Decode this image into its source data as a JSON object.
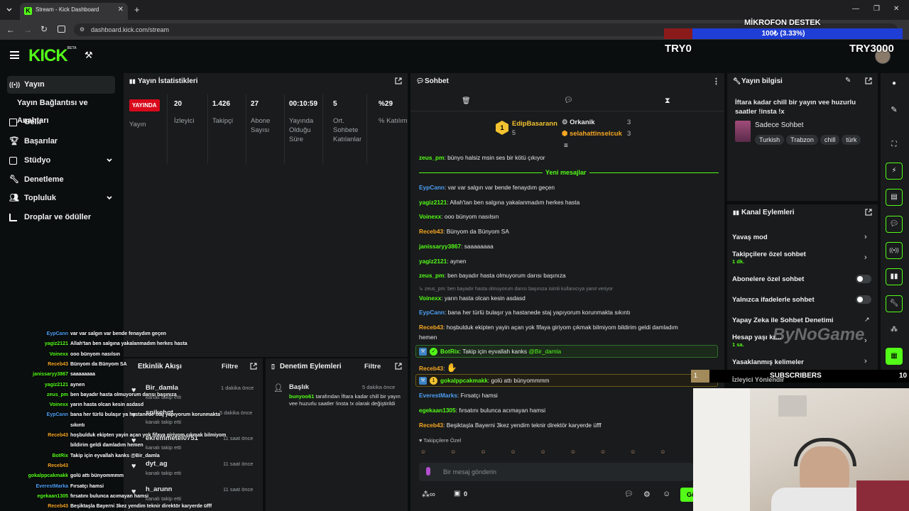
{
  "browser": {
    "tab_title": "Stream - Kick Dashboard",
    "url": "dashboard.kick.com/stream"
  },
  "brand": {
    "logo": "KICK",
    "beta": "BETA",
    "accent": "#53fc18"
  },
  "sidebar": {
    "items": [
      {
        "label": "Yayın",
        "icon": "broadcast-icon"
      },
      {
        "label": "Yayın Bağlantısı ve Anahtarı",
        "icon": ""
      },
      {
        "label": "Gelir",
        "icon": "revenue-icon"
      },
      {
        "label": "Başarılar",
        "icon": "trophy-icon"
      },
      {
        "label": "Stüdyo",
        "icon": "studio-icon"
      },
      {
        "label": "Denetleme",
        "icon": "wrench-icon"
      },
      {
        "label": "Topluluk",
        "icon": "community-icon"
      },
      {
        "label": "Droplar ve ödüller",
        "icon": "drops-icon"
      }
    ]
  },
  "stats": {
    "title": "Yayın İstatistikleri",
    "live": "YAYINDA",
    "live_label": "Yayın",
    "columns": [
      {
        "value": "20",
        "label": "İzleyici"
      },
      {
        "value": "1.426",
        "label": "Takipçi"
      },
      {
        "value": "27",
        "label": "Abone Sayısı"
      },
      {
        "value": "00:10:59",
        "label": "Yayında Olduğu Süre"
      },
      {
        "value": "5",
        "label": "Ort. Sohbete Katılanlar"
      },
      {
        "value": "%29",
        "label": "% Katılım"
      }
    ]
  },
  "chat": {
    "title": "Sohbet",
    "top_users": [
      {
        "rank": "1",
        "name": "EdipBasarann",
        "count": "5"
      },
      {
        "name": "Orkanik",
        "count": "3"
      },
      {
        "name": "selahattinselcuk",
        "count": "3"
      }
    ],
    "new_messages": "Yeni mesajlar",
    "messages": [
      {
        "user": "zeus_pm",
        "color": "#53fc18",
        "text": "bünyo halsiz msin ses bir kötü çıkıyor"
      },
      {
        "user": "EypCann",
        "color": "#4d9ff5",
        "text": "var var salgın var bende fenaydım geçen"
      },
      {
        "user": "yagiz2121",
        "color": "#53fc18",
        "text": "Allah'tan ben salgına yakalanmadım herkes hasta"
      },
      {
        "user": "Voinexx",
        "color": "#53fc18",
        "text": "ooo bünyom nasılsın"
      },
      {
        "user": "Receb43",
        "color": "#f5a623",
        "text": "Bünyom da Bünyom SA"
      },
      {
        "user": "janissaryy3867",
        "color": "#53fc18",
        "text": "saaaaaaaa"
      },
      {
        "user": "yagiz2121",
        "color": "#53fc18",
        "text": "aynen"
      },
      {
        "user": "zeus_pm",
        "color": "#53fc18",
        "text": "ben bayadır hasta olmuyorum darısı başınıza"
      },
      {
        "user": "Voinexx",
        "color": "#53fc18",
        "text": "yarın hasta olcan kesin asdasd"
      },
      {
        "user": "EypCann",
        "color": "#4d9ff5",
        "text": "bana her türlü bulaşır ya hastanede staj yapıyorum korunmakta sıkıntı"
      },
      {
        "user": "Receb43",
        "color": "#f5a623",
        "text": "hoşbulduk ekipten yayin açan yok fifaya giriyom çıkmak bilmiyom bildirim geldi damladım"
      },
      {
        "user": "Receb43",
        "color": "#f5a623",
        "text": ""
      },
      {
        "user": "EverestMarks",
        "color": "#4d9ff5",
        "text": "Fırsatçı hamsi"
      },
      {
        "user": "egekaan1305",
        "color": "#53fc18",
        "text": "fırsatını bulunca acımayan hamsi"
      },
      {
        "user": "Receb43",
        "color": "#f5a623",
        "text": "Beşiktaşla Bayerni 3kez yendim teknir direktör karyerde üfff"
      }
    ],
    "wrap_tail": "hemen",
    "reply_hint": "zeus_pm: ben bayadır hasta olmuyorum darısı başınıza isimli kullanıcıya yanıt veriyor",
    "bot": {
      "user": "BotRix",
      "text": "Takip için eyvallah kanks",
      "mention": "@Bir_damla"
    },
    "gold": {
      "user": "gokalppcakmakk",
      "text": "golü attı bünyommmm"
    },
    "followers_only": "Takipçilere Özel",
    "placeholder": "Bir mesaj gönderin",
    "footer_count": "0",
    "send_label": "Gö"
  },
  "info": {
    "title": "Yayın bilgisi",
    "stream_title": "İftara kadar chill bir yayın vee huzurlu saatler !insta !x",
    "category": "Sadece Sohbet",
    "tags": [
      "Turkish",
      "Trabzon",
      "chill",
      "türk"
    ]
  },
  "actions": {
    "title": "Kanal Eylemleri",
    "items": [
      {
        "label": "Yavaş mod",
        "sub": ""
      },
      {
        "label": "Takipçilere özel sohbet",
        "sub": "1 dk."
      },
      {
        "label": "Abonelere özel sohbet",
        "sub": ""
      },
      {
        "label": "Yalnızca ifadelerle sohbet",
        "sub": ""
      },
      {
        "label": "Yapay Zeka ile Sohbet Denetimi",
        "sub": ""
      },
      {
        "label": "Hesap yaşı kısıtlaması",
        "sub": "1 sa."
      },
      {
        "label": "Yasaklanmış kelimeler",
        "sub": ""
      },
      {
        "label": "İzleyici Yönlendir",
        "sub": ""
      }
    ]
  },
  "feed": {
    "title": "Etkinlik Akışı",
    "filter": "Filtre",
    "items": [
      {
        "name": "Bir_damla",
        "sub": "kanalı takip etti",
        "time": "1 dakika önce"
      },
      {
        "name": "spikehqt",
        "sub": "kanalı takip etti",
        "time": "5 dakika önce"
      },
      {
        "name": "ekremmetel0751",
        "sub": "kanalı takip etti",
        "time": "11 saat önce"
      },
      {
        "name": "dyt_ag",
        "sub": "kanalı takip etti",
        "time": "11 saat önce"
      },
      {
        "name": "h_arunn",
        "sub": "kanalı takip etti",
        "time": "11 saat önce"
      }
    ]
  },
  "moderation": {
    "title": "Denetim Eylemleri",
    "filter": "Filtre",
    "item": {
      "label": "Başlık",
      "time": "5 dakika önce",
      "user": "bunyoo61",
      "text": "tarafından İftara kadar chill bir yayın vee huzurlu saatler !insta !x olarak değiştirildi"
    }
  },
  "overlay": {
    "mic_title": "MİKROFON DESTEK",
    "mic_progress": "100₺ (3.33%)",
    "mic_fraction": 0.0333,
    "goal_left": "TRY0",
    "goal_right": "TRY3000",
    "watermark": "ByNoGame",
    "subs_label": "SUBSCRIBERS",
    "subs_count": "10",
    "subs_level": "1"
  },
  "overlay_chat": [
    {
      "u": "EypCann",
      "c": "#4d9ff5",
      "t": "var var salgın var bende fenaydım geçen"
    },
    {
      "u": "yagiz2121",
      "c": "#53fc18",
      "t": "Allah'tan ben salgına yakalanmadım herkes hasta"
    },
    {
      "u": "Voinexx",
      "c": "#53fc18",
      "t": "ooo bünyom nasılsın"
    },
    {
      "u": "Receb43",
      "c": "#f5a623",
      "t": "Bünyom da Bünyom SA"
    },
    {
      "u": "janissaryy3867",
      "c": "#53fc18",
      "t": "saaaaaaaa"
    },
    {
      "u": "yagiz2121",
      "c": "#53fc18",
      "t": "aynen"
    },
    {
      "u": "zeus_pm",
      "c": "#53fc18",
      "t": "ben bayadır hasta olmuyorum darısı başınıza"
    },
    {
      "u": "Voinexx",
      "c": "#53fc18",
      "t": "yarın hasta olcan kesin asdasd"
    },
    {
      "u": "EypCann",
      "c": "#4d9ff5",
      "t": "bana her türlü bulaşır ya hastanede staj yapıyorum korunmakta"
    },
    {
      "u": "",
      "c": "#fff",
      "t": "sıkıntı"
    },
    {
      "u": "Receb43",
      "c": "#f5a623",
      "t": "hoşbulduk ekipten yayin açan yok fifaya giriyom çıkmak bilmiyom"
    },
    {
      "u": "",
      "c": "#fff",
      "t": "bildirim geldi damladım hemen"
    },
    {
      "u": "BotRix",
      "c": "#53fc18",
      "t": "Takip için eyvallah kanks @Bir_damla"
    },
    {
      "u": "Receb43",
      "c": "#f5a623",
      "t": ""
    },
    {
      "u": "gokalppcakmakk",
      "c": "#53fc18",
      "t": "golü attı bünyommmm"
    },
    {
      "u": "EverestMarka",
      "c": "#4d9ff5",
      "t": "Fırsatçı hamsi"
    },
    {
      "u": "egekaan1305",
      "c": "#53fc18",
      "t": "fırsatını bulunca acımayan hamsi"
    },
    {
      "u": "Receb43",
      "c": "#f5a623",
      "t": "Beşiktaşla Bayerni 3kez yendim teknir direktör karyerde üfff"
    }
  ]
}
